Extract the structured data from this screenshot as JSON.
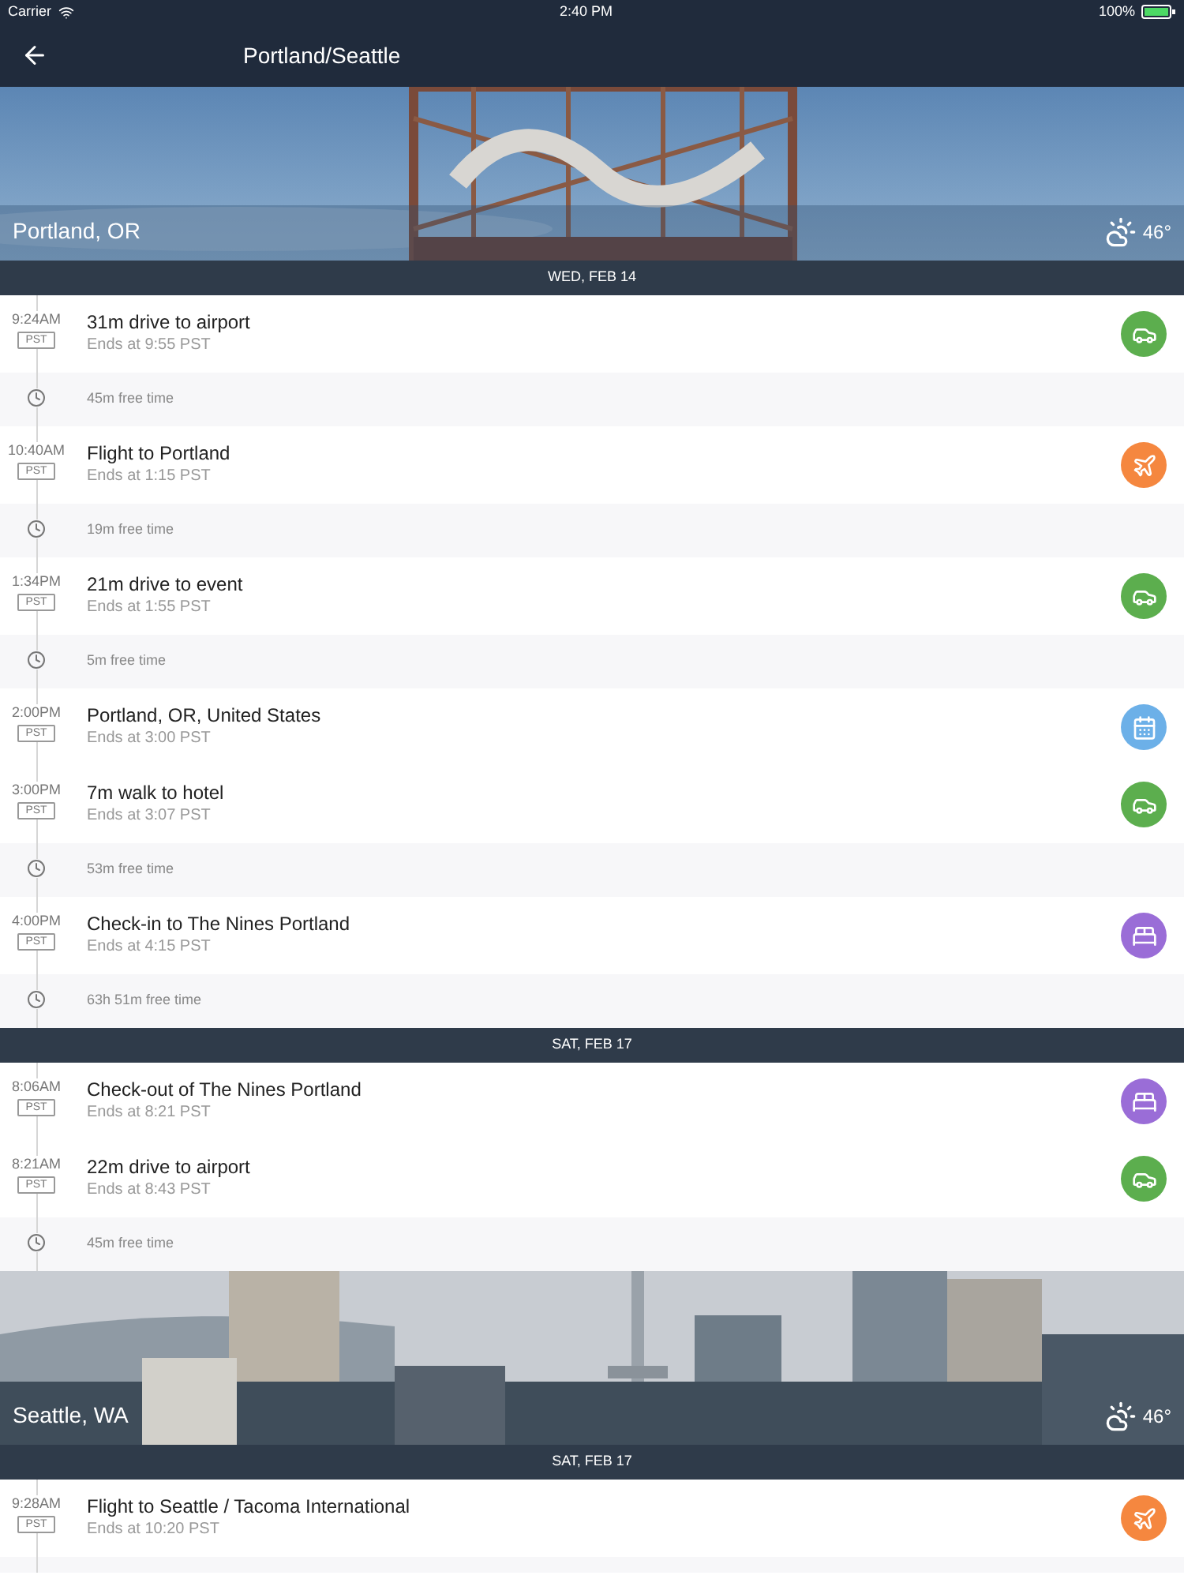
{
  "status_bar": {
    "carrier": "Carrier",
    "time": "2:40 PM",
    "battery": "100%"
  },
  "nav": {
    "title": "Portland/Seattle"
  },
  "timeline": [
    {
      "kind": "city",
      "name": "Portland, OR",
      "temp": "46°"
    },
    {
      "kind": "date",
      "label": "WED, FEB 14"
    },
    {
      "kind": "drive",
      "time": "9:24AM",
      "tz": "PST",
      "title": "31m drive to airport",
      "subtitle": "Ends at 9:55 PST",
      "color": "#5cae4e"
    },
    {
      "kind": "free",
      "text": "45m free time"
    },
    {
      "kind": "flight",
      "time": "10:40AM",
      "tz": "PST",
      "title": "Flight to Portland",
      "subtitle": "Ends at 1:15 PST",
      "color": "#f5873f"
    },
    {
      "kind": "free",
      "text": "19m free time"
    },
    {
      "kind": "drive",
      "time": "1:34PM",
      "tz": "PST",
      "title": "21m drive to event",
      "subtitle": "Ends at 1:55 PST",
      "color": "#5cae4e"
    },
    {
      "kind": "free",
      "text": "5m free time"
    },
    {
      "kind": "place",
      "time": "2:00PM",
      "tz": "PST",
      "title": "Portland, OR, United States",
      "subtitle": "Ends at 3:00 PST",
      "color": "#6cb0e8"
    },
    {
      "kind": "drive",
      "time": "3:00PM",
      "tz": "PST",
      "title": "7m walk to hotel",
      "subtitle": "Ends at 3:07 PST",
      "color": "#5cae4e"
    },
    {
      "kind": "free",
      "text": "53m free time"
    },
    {
      "kind": "hotel",
      "time": "4:00PM",
      "tz": "PST",
      "title": "Check-in to The Nines Portland",
      "subtitle": "Ends at 4:15 PST",
      "color": "#9a6dd7"
    },
    {
      "kind": "free",
      "text": "63h 51m free time"
    },
    {
      "kind": "date",
      "label": "SAT, FEB 17"
    },
    {
      "kind": "hotel",
      "time": "8:06AM",
      "tz": "PST",
      "title": "Check-out of The Nines Portland",
      "subtitle": "Ends at 8:21 PST",
      "color": "#9a6dd7"
    },
    {
      "kind": "drive",
      "time": "8:21AM",
      "tz": "PST",
      "title": "22m drive to airport",
      "subtitle": "Ends at 8:43 PST",
      "color": "#5cae4e"
    },
    {
      "kind": "free",
      "text": "45m free time"
    },
    {
      "kind": "city",
      "name": "Seattle, WA",
      "temp": "46°"
    },
    {
      "kind": "date",
      "label": "SAT, FEB 17"
    },
    {
      "kind": "flight",
      "time": "9:28AM",
      "tz": "PST",
      "title": "Flight to Seattle / Tacoma International",
      "subtitle": "Ends at 10:20 PST",
      "color": "#f5873f"
    }
  ]
}
